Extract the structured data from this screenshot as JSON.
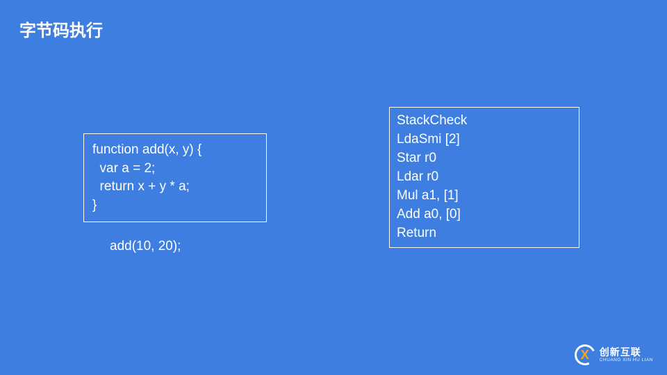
{
  "title": "字节码执行",
  "source_code": "function add(x, y) {\n  var a = 2;\n  return x + y * a;\n}",
  "call_expression": "add(10, 20);",
  "bytecode": "StackCheck\nLdaSmi [2]\nStar r0\nLdar r0\nMul a1, [1]\nAdd a0, [0]\nReturn",
  "logo": {
    "mark_letter": "X",
    "brand_cn": "创新互联",
    "brand_en": "CHUANG XIN HU LIAN"
  },
  "colors": {
    "background": "#3d7ee0",
    "text": "#ffffff",
    "accent": "#f5a623"
  }
}
